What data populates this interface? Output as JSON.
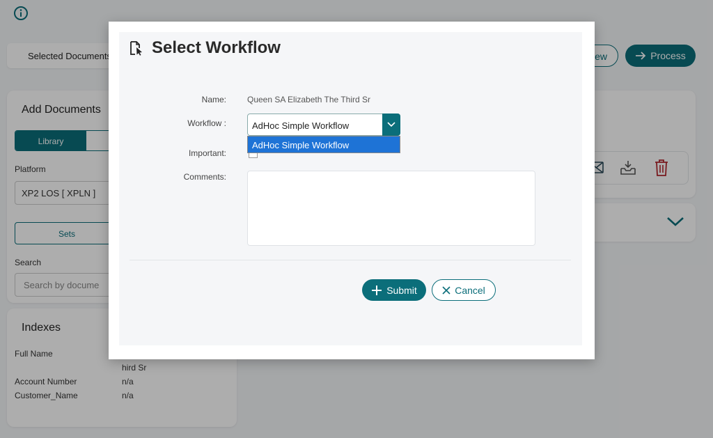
{
  "background": {
    "selected_documents_label": "Selected Documents",
    "view_button_label": "iew",
    "process_button_label": "Process",
    "add_documents": {
      "title": "Add Documents",
      "library_tab_label": "Library",
      "platform_label": "Platform",
      "platform_value": "XP2 LOS [ XPLN ]",
      "sets_button_label": "Sets",
      "search_label": "Search",
      "search_placeholder": "Search by docume"
    },
    "indexes": {
      "title": "Indexes",
      "rows": [
        {
          "label": "Full Name",
          "value": "hird Sr"
        },
        {
          "label": "Account Number",
          "value": "n/a"
        },
        {
          "label": "Customer_Name",
          "value": "n/a"
        }
      ]
    },
    "icons": [
      "info-icon",
      "mail-icon",
      "inbox-download-icon",
      "trash-icon",
      "chevron-down-icon"
    ]
  },
  "modal": {
    "title": "Select Workflow",
    "name_label": "Name:",
    "name_value": "Queen SA Elizabeth The Third Sr",
    "workflow_label": "Workflow :",
    "workflow_selected": "AdHoc Simple Workflow",
    "workflow_options": [
      "AdHoc Simple Workflow"
    ],
    "important_label": "Important:",
    "comments_label": "Comments:",
    "comments_value": "",
    "submit_label": "Submit",
    "cancel_label": "Cancel"
  },
  "colors": {
    "accent": "#0b6e7a",
    "dropdown_highlight": "#1e73d6",
    "danger": "#b3262d"
  }
}
